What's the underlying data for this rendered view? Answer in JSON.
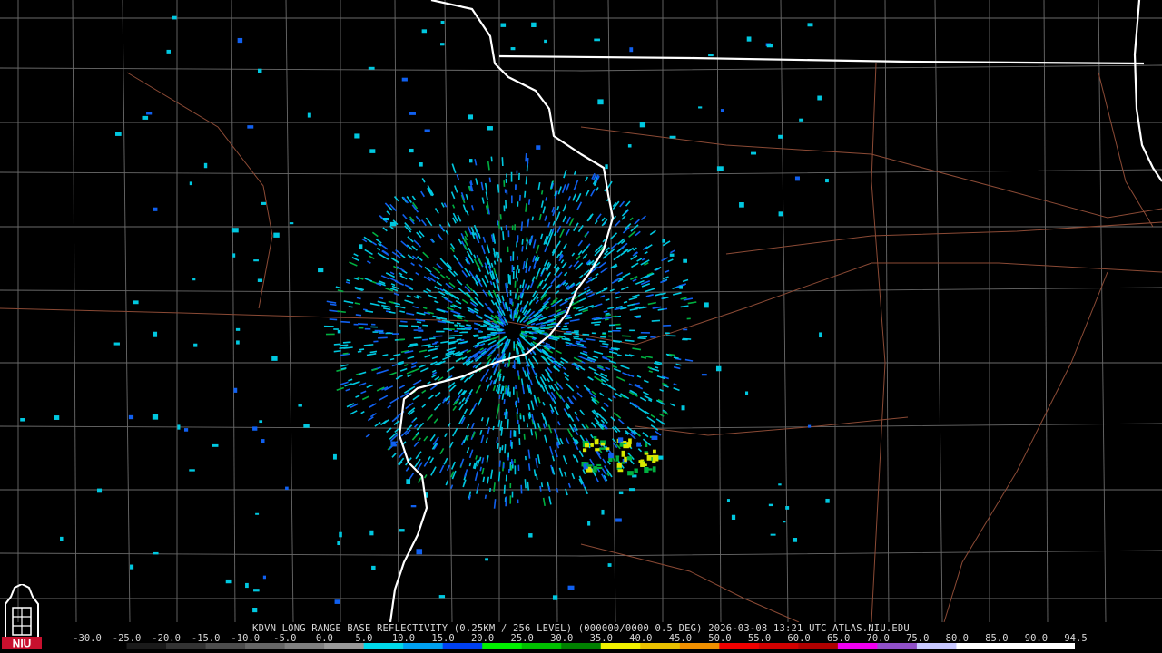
{
  "product": {
    "title": "KDVN LONG RANGE BASE REFLECTIVITY (0.25KM / 256 LEVEL) (000000/0000 0.5 DEG) 2026-03-08 13:21 UTC  ATLAS.NIU.EDU"
  },
  "logo": {
    "text": "NIU",
    "accent_color": "#c8102e"
  },
  "scale": {
    "labels": [
      "-30.0",
      "-25.0",
      "-20.0",
      "-15.0",
      "-10.0",
      "-5.0",
      "0.0",
      "5.0",
      "10.0",
      "15.0",
      "20.0",
      "25.0",
      "30.0",
      "35.0",
      "40.0",
      "45.0",
      "50.0",
      "55.0",
      "60.0",
      "65.0",
      "70.0",
      "75.0",
      "80.0",
      "85.0",
      "90.0",
      "94.5"
    ],
    "colors": [
      "#000000",
      "#1a1a1a",
      "#333333",
      "#4d4d4d",
      "#666666",
      "#7f7f7f",
      "#999999",
      "#00d8e8",
      "#00a0f0",
      "#0040f0",
      "#00f000",
      "#00c000",
      "#008000",
      "#f0f000",
      "#e8c000",
      "#f09000",
      "#f00000",
      "#d00000",
      "#b00000",
      "#f000f0",
      "#9050c8",
      "#c8c8ff",
      "#ffffff",
      "#ffffff",
      "#ffffff"
    ]
  },
  "map": {
    "colors": {
      "background": "#000000",
      "county_lines": "#6a6a6a",
      "state_lines": "#ffffff",
      "highways": "#8b4a35",
      "echo_light": "#00c8e0",
      "echo_mid": "#1060f0",
      "echo_green": "#00b040",
      "echo_yellow": "#d8e800"
    }
  }
}
